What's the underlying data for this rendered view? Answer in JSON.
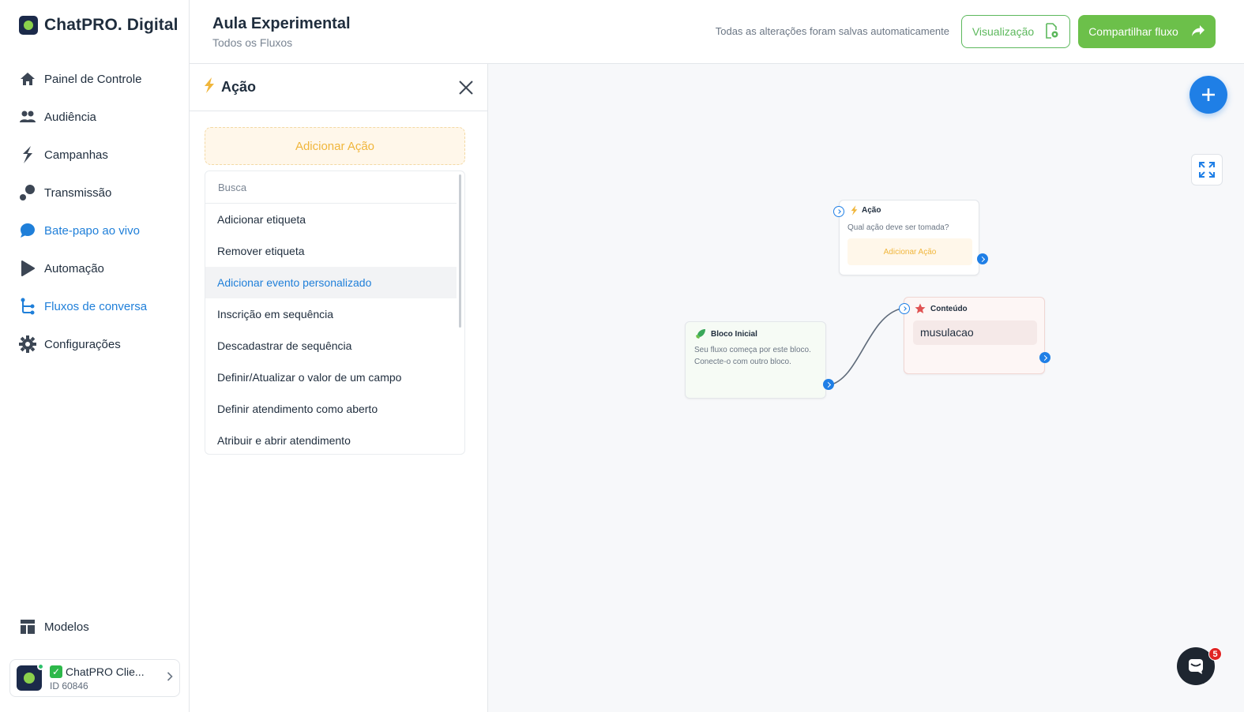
{
  "brand": {
    "name": "ChatPRO. Digital"
  },
  "sidebar": {
    "items": [
      {
        "label": "Painel de Controle",
        "icon": "home-icon"
      },
      {
        "label": "Audiência",
        "icon": "users-icon"
      },
      {
        "label": "Campanhas",
        "icon": "bolt-icon"
      },
      {
        "label": "Transmissão",
        "icon": "broadcast-icon"
      },
      {
        "label": "Bate-papo ao vivo",
        "icon": "chat-bubble-icon"
      },
      {
        "label": "Automação",
        "icon": "play-icon"
      },
      {
        "label": "Fluxos de conversa",
        "icon": "flow-icon"
      },
      {
        "label": "Configurações",
        "icon": "gear-icon"
      }
    ],
    "bottom": {
      "label": "Modelos",
      "icon": "templates-icon"
    },
    "account": {
      "name": "ChatPRO Clie...",
      "id": "ID 60846"
    }
  },
  "header": {
    "title": "Aula Experimental",
    "breadcrumb": "Todos os Fluxos",
    "save_status": "Todas as alterações foram salvas automaticamente",
    "preview_label": "Visualização",
    "share_label": "Compartilhar fluxo"
  },
  "panel": {
    "title": "Ação",
    "add_action_label": "Adicionar Ação",
    "search_placeholder": "Busca",
    "options": [
      "Adicionar etiqueta",
      "Remover etiqueta",
      "Adicionar evento personalizado",
      "Inscrição em sequência",
      "Descadastrar de sequência",
      "Definir/Atualizar o valor de um campo",
      "Definir atendimento como aberto",
      "Atribuir e abrir atendimento"
    ]
  },
  "canvas": {
    "start_node": {
      "title": "Bloco Inicial",
      "text": "Seu fluxo começa por este bloco. Conecte-o com outro bloco."
    },
    "action_node": {
      "title": "Ação",
      "question": "Qual ação deve ser tomada?",
      "add_label": "Adicionar Ação"
    },
    "content_node": {
      "title": "Conteúdo",
      "message": "musulacao"
    }
  },
  "chat_widget": {
    "badge": "5"
  },
  "colors": {
    "accent_blue": "#1f7fe6",
    "green": "#6cc04a",
    "action_yellow": "#f0b63c",
    "content_red": "#e05252"
  }
}
